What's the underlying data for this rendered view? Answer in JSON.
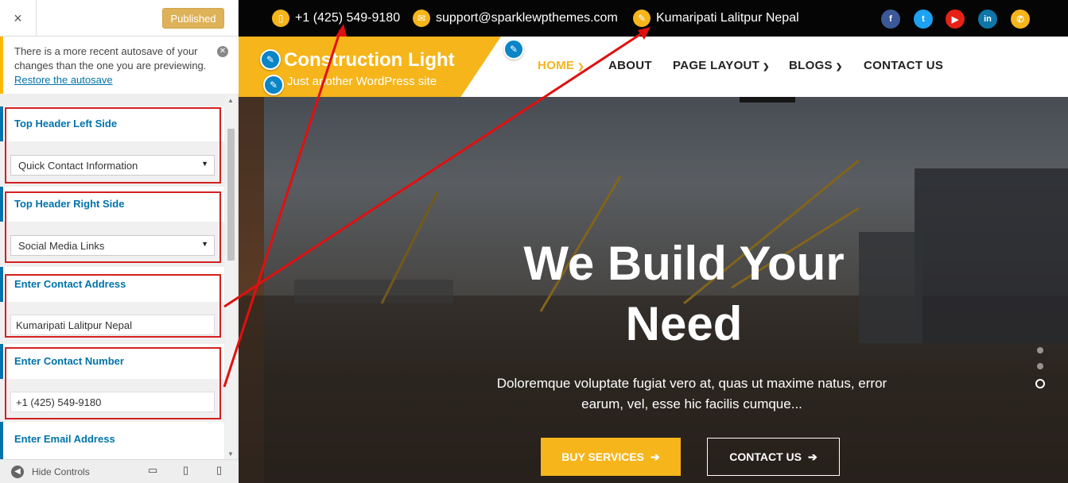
{
  "sidebar": {
    "close_label": "×",
    "publish_label": "Published",
    "autosave": {
      "message": "There is a more recent autosave of your changes than the one you are previewing.",
      "link": "Restore the autosave"
    },
    "controls": {
      "left_side": {
        "title": "Top Header Left Side",
        "value": "Quick Contact Information"
      },
      "right_side": {
        "title": "Top Header Right Side",
        "value": "Social Media Links"
      },
      "address": {
        "title": "Enter Contact Address",
        "value": "Kumaripati Lalitpur Nepal"
      },
      "number": {
        "title": "Enter Contact Number",
        "value": "+1 (425) 549-9180"
      },
      "email": {
        "title": "Enter Email Address"
      }
    },
    "footer": {
      "hide_label": "Hide Controls"
    }
  },
  "preview": {
    "topbar": {
      "phone": "+1 (425) 549-9180",
      "email": "support@sparklewpthemes.com",
      "address": "Kumaripati Lalitpur Nepal",
      "social": [
        "facebook",
        "twitter",
        "youtube",
        "linkedin",
        "phone"
      ]
    },
    "site": {
      "title": "Construction Light",
      "tagline": "Just another WordPress site"
    },
    "nav": {
      "home": "HOME",
      "about": "ABOUT",
      "page_layout": "PAGE LAYOUT",
      "blogs": "BLOGS",
      "contact": "CONTACT US"
    },
    "hero": {
      "title": "We Build Your Need",
      "text": "Doloremque voluptate fugiat vero at, quas ut maxime natus, error earum, vel, esse hic facilis cumque...",
      "btn_buy": "BUY SERVICES",
      "btn_contact": "CONTACT US"
    }
  },
  "colors": {
    "accent": "#f5b51b",
    "wp_blue": "#0073aa",
    "annotation_red": "#d42020"
  }
}
